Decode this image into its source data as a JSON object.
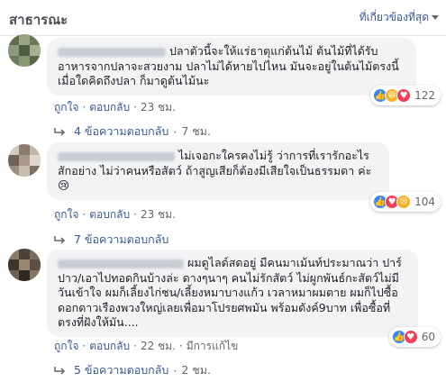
{
  "header": {
    "title": "สาธารณะ",
    "sort_label": "ที่เกี่ยวข้องที่สุด"
  },
  "comments": [
    {
      "text": "ปลาตัวนี้จะให้แร่ธาตุแก่ต้นไม้ ต้นไม้ที่ได้รับอาหารจากปลาจะสวยงาม ปลาไม่ได้หายไปไหน มันจะอยู่ในต้นไม้ตรงนี้ เมื่อใดคิดถึงปลา ก็มาดูต้นไม้นะ",
      "reactions": [
        "like",
        "haha",
        "love"
      ],
      "reaction_count": "122",
      "like_label": "ถูกใจ",
      "reply_label": "ตอบกลับ",
      "time": "23 ชม.",
      "edited": "",
      "replies_label": "4 ข้อความตอบกลับ",
      "replies_time": "7 ชม."
    },
    {
      "text": "ไม่เจอกะใครคงไม่รู้ ว่าการที่เรารักอะไรสักอย่าง ไม่ว่าคนหรือสัตว์ ถ้าสูญเสียก็ต้องมีเสียใจเป็นธรรมดา ค่ะ 😢",
      "reactions": [
        "like",
        "love",
        "sad"
      ],
      "reaction_count": "104",
      "like_label": "ถูกใจ",
      "reply_label": "ตอบกลับ",
      "time": "23 ชม.",
      "edited": "",
      "replies_label": "7 ข้อความตอบกลับ",
      "replies_time": ""
    },
    {
      "text": "ผมดูไลด์สดอยู่ มีคนมาเม้นท์ประมาณว่า ปาร์ปาว/เอาไปทอดกินบ้างล่ะ ดางๆนาๆ คนไม่รักสัตว์ ไม่ผูกพันธ์กะสัตว์ไม่มีวันเข้าใจ ผมก็เลี้ยงไก่ชน/เลี้ยงหมาบางแก้ว เวลาหมาผมตาย ผมก็ไปซื้อดอกดาวเรืองพวงใหญ่เลยเพื่อมาโปรยศพมัน พร้อมดังค์9บาท เพื่อซื้อที่ตรงที่ฝังให้มัน....",
      "reactions": [
        "like",
        "love"
      ],
      "reaction_count": "60",
      "like_label": "ถูกใจ",
      "reply_label": "ตอบกลับ",
      "time": "22 ชม.",
      "edited": "มีการแก้ไข",
      "replies_label": "5 ข้อความตอบกลับ",
      "replies_time": "2 ชม."
    }
  ]
}
